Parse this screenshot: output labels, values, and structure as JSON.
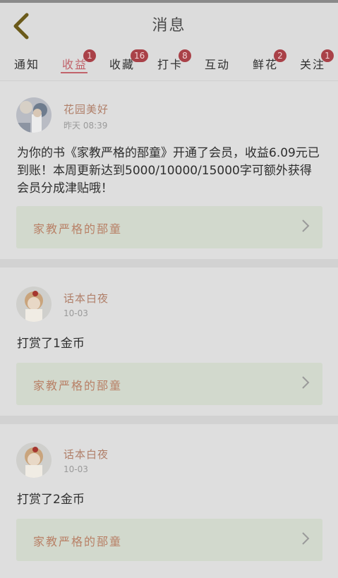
{
  "header": {
    "title": "消息",
    "back_icon": "chevron-left-icon"
  },
  "tabs": [
    {
      "label": "通知",
      "badge": "",
      "active": false
    },
    {
      "label": "收益",
      "badge": "1",
      "active": true
    },
    {
      "label": "收藏",
      "badge": "16",
      "active": false
    },
    {
      "label": "打卡",
      "badge": "8",
      "active": false
    },
    {
      "label": "互动",
      "badge": "",
      "active": false
    },
    {
      "label": "鲜花",
      "badge": "2",
      "active": false
    },
    {
      "label": "关注",
      "badge": "1",
      "active": false
    }
  ],
  "messages": [
    {
      "author": "花园美好",
      "time": "昨天 08:39",
      "content": "为你的书《家教严格的郚童》开通了会员，收益6.09元已到账！本周更新达到5000/10000/15000字可额外获得会员分成津贴哦！",
      "book_title": "家教严格的郚童",
      "avatar_icon": "user-avatar-flowers"
    },
    {
      "author": "话本白夜",
      "time": "10-03",
      "content": "打赏了1金币",
      "book_title": "家教严格的郚童",
      "avatar_icon": "user-avatar-child"
    },
    {
      "author": "话本白夜",
      "time": "10-03",
      "content": "打赏了2金币",
      "book_title": "家教严格的郚童",
      "avatar_icon": "user-avatar-child"
    }
  ],
  "colors": {
    "accent": "#c1636b",
    "badge": "#a94148",
    "author": "#b07f69",
    "book_bg": "#d2d9cd"
  }
}
